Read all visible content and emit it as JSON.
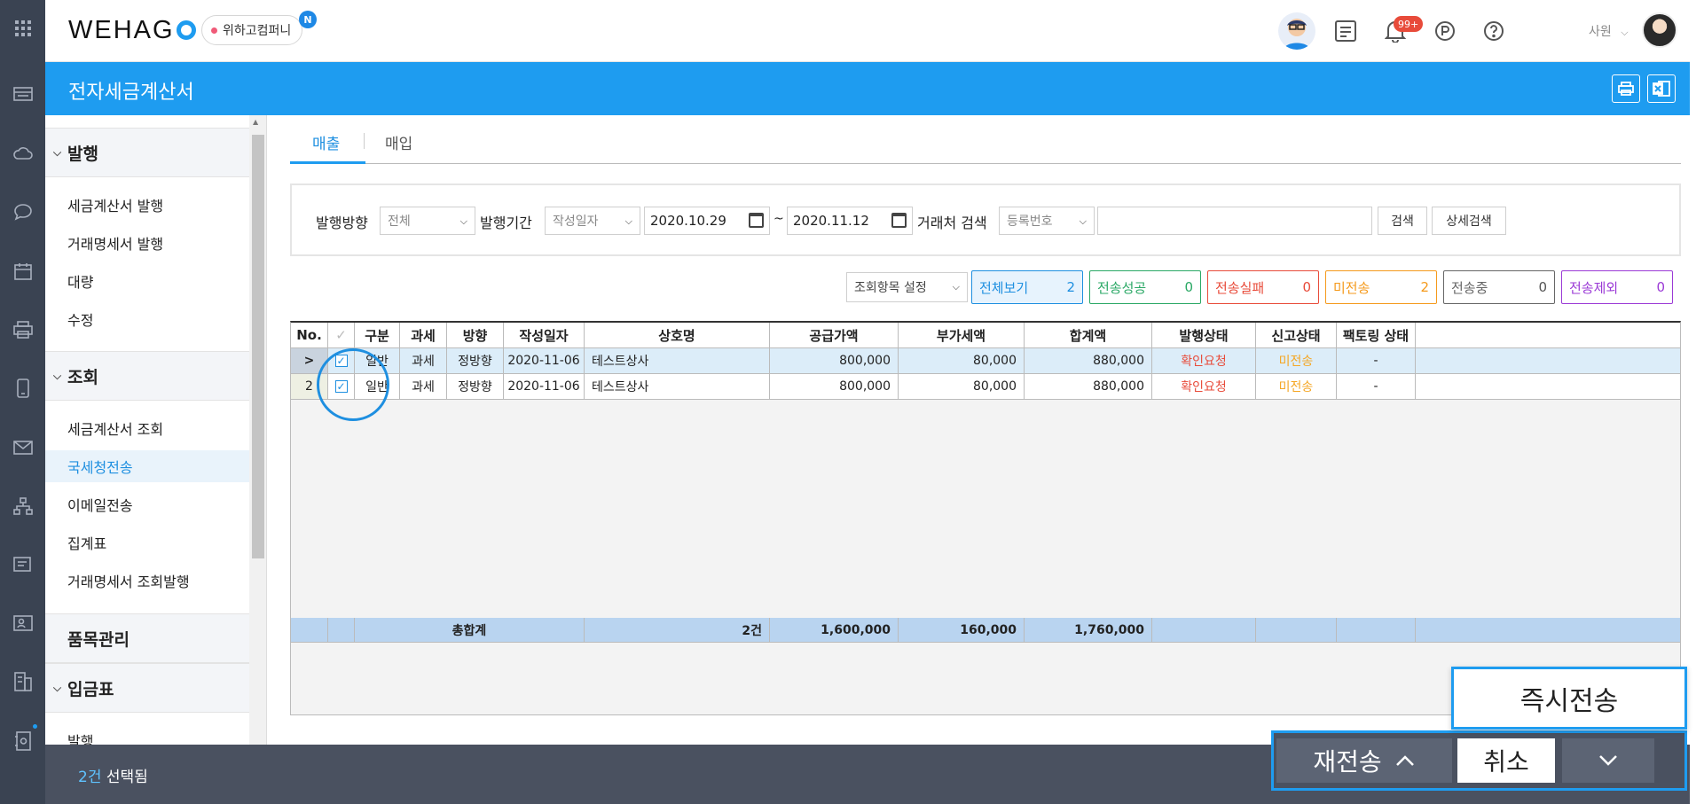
{
  "brand": {
    "logo_text": "WEHAG",
    "company": "위하고컴퍼니",
    "company_badge": "N"
  },
  "header": {
    "notification_count": "99+",
    "user_role": "사원"
  },
  "title_bar": {
    "title": "전자세금계산서"
  },
  "sidebar": {
    "sections": [
      {
        "label": "발행",
        "items": [
          "세금계산서 발행",
          "거래명세서 발행",
          "대량",
          "수정"
        ]
      },
      {
        "label": "조회",
        "items": [
          "세금계산서 조회",
          "국세청전송",
          "이메일전송",
          "집계표",
          "거래명세서 조회발행"
        ],
        "active": "국세청전송"
      },
      {
        "label": "품목관리",
        "items": []
      },
      {
        "label": "입금표",
        "items": [
          "발행"
        ]
      }
    ]
  },
  "tabs": [
    "매출",
    "매입"
  ],
  "filter": {
    "direction_label": "발행방향",
    "direction_value": "전체",
    "period_label": "발행기간",
    "period_type": "작성일자",
    "date_from": "2020.10.29",
    "tilde": "~",
    "date_to": "2020.11.12",
    "partner_label": "거래처 검색",
    "partner_type": "등록번호",
    "partner_value": "",
    "search_btn": "검색",
    "detail_btn": "상세검색"
  },
  "column_setting": "조회항목 설정",
  "stats": [
    {
      "label": "전체보기",
      "count": "2",
      "color": "#1e8fe0"
    },
    {
      "label": "전송성공",
      "count": "0",
      "color": "#2aa865"
    },
    {
      "label": "전송실패",
      "count": "0",
      "color": "#e84b3a"
    },
    {
      "label": "미전송",
      "count": "2",
      "color": "#f59a1c"
    },
    {
      "label": "전송중",
      "count": "0",
      "color": "#666666"
    },
    {
      "label": "전송제외",
      "count": "0",
      "color": "#9b3ad6"
    }
  ],
  "table": {
    "headers": [
      "No.",
      "✓",
      "구분",
      "과세",
      "방향",
      "작성일자",
      "상호명",
      "공급가액",
      "부가세액",
      "합계액",
      "발행상태",
      "신고상태",
      "팩토링 상태"
    ],
    "rows": [
      {
        "no": ">",
        "type": "일반",
        "tax": "과세",
        "dir": "정방향",
        "date": "2020-11-06",
        "name": "테스트상사",
        "supply": "800,000",
        "vat": "80,000",
        "total": "880,000",
        "issue": "확인요청",
        "report": "미전송",
        "factoring": "-"
      },
      {
        "no": "2",
        "type": "일반",
        "tax": "과세",
        "dir": "정방향",
        "date": "2020-11-06",
        "name": "테스트상사",
        "supply": "800,000",
        "vat": "80,000",
        "total": "880,000",
        "issue": "확인요청",
        "report": "미전송",
        "factoring": "-"
      }
    ],
    "summary": {
      "label": "총합계",
      "count": "2건",
      "supply": "1,600,000",
      "vat": "160,000",
      "total": "1,760,000"
    }
  },
  "footer": {
    "count": "2건",
    "selected_text": "선택됨"
  },
  "actions": {
    "resend": "재전송",
    "cancel": "취소",
    "popup": "즉시전송"
  }
}
